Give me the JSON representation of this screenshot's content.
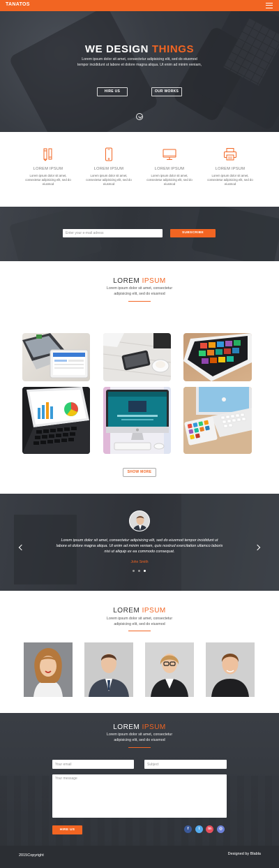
{
  "nav": {
    "brand": "TANATOS",
    "menu_icon": "hamburger-icon"
  },
  "hero": {
    "title_main": "WE DESIGN",
    "title_accent": "THINGS",
    "text": "Lorem ipsum dolor sit amet, consectetur adipisicing elit, sed do eiusmod tempor incididunt ut labore et dolore magna aliqua. Ut enim ad minim veniam,",
    "hire_label": "HIRE US",
    "works_label": "OUR WORKS",
    "scroll_icon": "chevron-down-icon"
  },
  "features": [
    {
      "icon": "pencil-icon",
      "title": "LOREM IPSUM",
      "text": "Lorem ipsum dolor sit amet, consectetur adipisicing elit, sed do eiusmod"
    },
    {
      "icon": "phone-icon",
      "title": "LOREM IPSUM",
      "text": "Lorem ipsum dolor sit amet, consectetur adipisicing elit, sed do eiusmod"
    },
    {
      "icon": "monitor-icon",
      "title": "LOREM IPSUM",
      "text": "Lorem ipsum dolor sit amet, consectetur adipisicing elit, sed do eiusmod"
    },
    {
      "icon": "printer-icon",
      "title": "LOREM IPSUM",
      "text": "Lorem ipsum dolor sit amet, consectetur adipisicing elit, sed do eiusmod"
    }
  ],
  "subscribe": {
    "placeholder": "Enter your e-mail adress",
    "button": "SUBSCRIBE"
  },
  "portfolio": {
    "title_main": "LOREM",
    "title_accent": "IPSUM",
    "subtitle": "Lorem ipsum dolor sit amet, consectetur adipisicing elit, sed do eiusmod",
    "show_more": "SHOW MORE"
  },
  "testimonial": {
    "quote": "Lorem ipsum dolor sit amet, consectetur adipisicing elit, sed do eiusmod tempor incididunt ut labore et dolore magna aliqua. Ut enim ad minim veniam, quis nostrud exercitation ullamco laboris nisi ut aliquip ex ea commodo consequat.",
    "author": "John Smith"
  },
  "team": {
    "title_main": "LOREM",
    "title_accent": "IPSUM",
    "subtitle": "Lorem ipsum dolor sit amet, consectetur adipisicing elit, sed do eiusmod"
  },
  "contact": {
    "title_main": "LOREM",
    "title_accent": "IPSUM",
    "subtitle": "Lorem ipsum dolor sit amet, consectetur adipisicing elit, sed do eiusmod",
    "email_placeholder": "Your email",
    "subject_placeholder": "Subject",
    "message_placeholder": "Your message",
    "button": "HIRE US",
    "social": {
      "facebook": "f",
      "twitter": "t",
      "linkedin": "in",
      "dribbble": "◎"
    }
  },
  "footer": {
    "copyright": "2015Copyright",
    "designed": "Designed by Blabla"
  },
  "colors": {
    "accent": "#f26522",
    "dark": "#35393f"
  }
}
